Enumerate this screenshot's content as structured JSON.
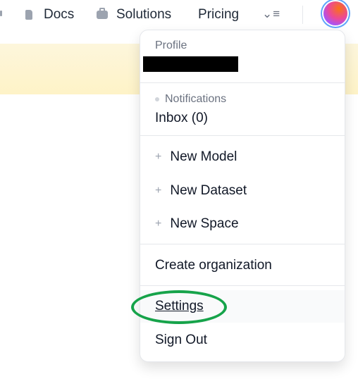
{
  "topnav": {
    "items": [
      {
        "label": "Docs",
        "icon": "doc-icon"
      },
      {
        "label": "Solutions",
        "icon": "briefcase-icon"
      },
      {
        "label": "Pricing"
      }
    ],
    "more_icon": "⌄≡"
  },
  "menu": {
    "profile_label": "Profile",
    "notifications_label": "Notifications",
    "inbox_label": "Inbox (0)",
    "new_items": [
      "New Model",
      "New Dataset",
      "New Space"
    ],
    "create_org": "Create organization",
    "settings": "Settings",
    "sign_out": "Sign Out"
  },
  "colors": {
    "banner": "#fef3c7",
    "annotation_circle": "#16a34a",
    "avatar_ring": "#60a5fa"
  }
}
